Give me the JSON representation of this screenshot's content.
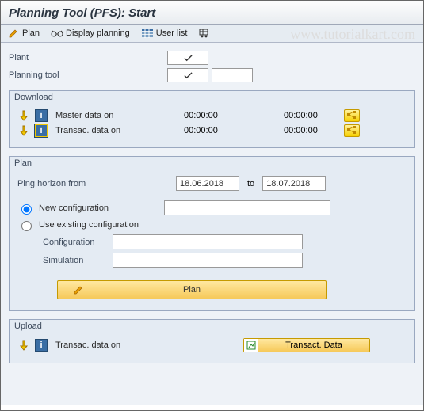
{
  "title": "Planning Tool (PFS): Start",
  "watermark": "www.tutorialkart.com",
  "toolbar": {
    "plan": "Plan",
    "display": "Display planning",
    "userlist": "User list"
  },
  "form": {
    "plant_label": "Plant",
    "planning_tool_label": "Planning tool"
  },
  "download": {
    "legend": "Download",
    "master_label": "Master data on",
    "master_t1": "00:00:00",
    "master_t2": "00:00:00",
    "transac_label": "Transac. data on",
    "transac_t1": "00:00:00",
    "transac_t2": "00:00:00"
  },
  "plan": {
    "legend": "Plan",
    "horizon_label": "Plng horizon from",
    "from_date": "18.06.2018",
    "to_label": "to",
    "to_date": "18.07.2018",
    "new_config_label": "New configuration",
    "use_existing_label": "Use existing configuration",
    "config_label": "Configuration",
    "sim_label": "Simulation",
    "plan_button": "Plan"
  },
  "upload": {
    "legend": "Upload",
    "transac_label": "Transac. data on",
    "button": "Transact. Data"
  }
}
